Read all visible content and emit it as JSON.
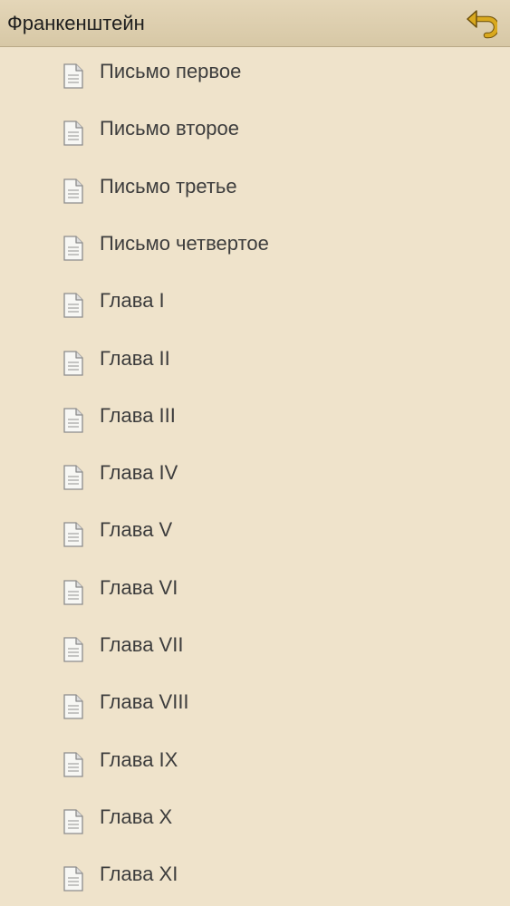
{
  "header": {
    "title": "Франкенштейн",
    "back_icon": "back-arrow-icon",
    "accent_color": "#c79a1e"
  },
  "chapters": {
    "icon": "document-icon",
    "items": [
      {
        "label": "Письмо первое"
      },
      {
        "label": "Письмо второе"
      },
      {
        "label": "Письмо третье"
      },
      {
        "label": "Письмо четвертое"
      },
      {
        "label": "Глава I"
      },
      {
        "label": "Глава II"
      },
      {
        "label": "Глава III"
      },
      {
        "label": "Глава IV"
      },
      {
        "label": "Глава V"
      },
      {
        "label": "Глава VI"
      },
      {
        "label": "Глава VII"
      },
      {
        "label": "Глава VIII"
      },
      {
        "label": "Глава IX"
      },
      {
        "label": "Глава X"
      },
      {
        "label": "Глава XI"
      }
    ]
  }
}
